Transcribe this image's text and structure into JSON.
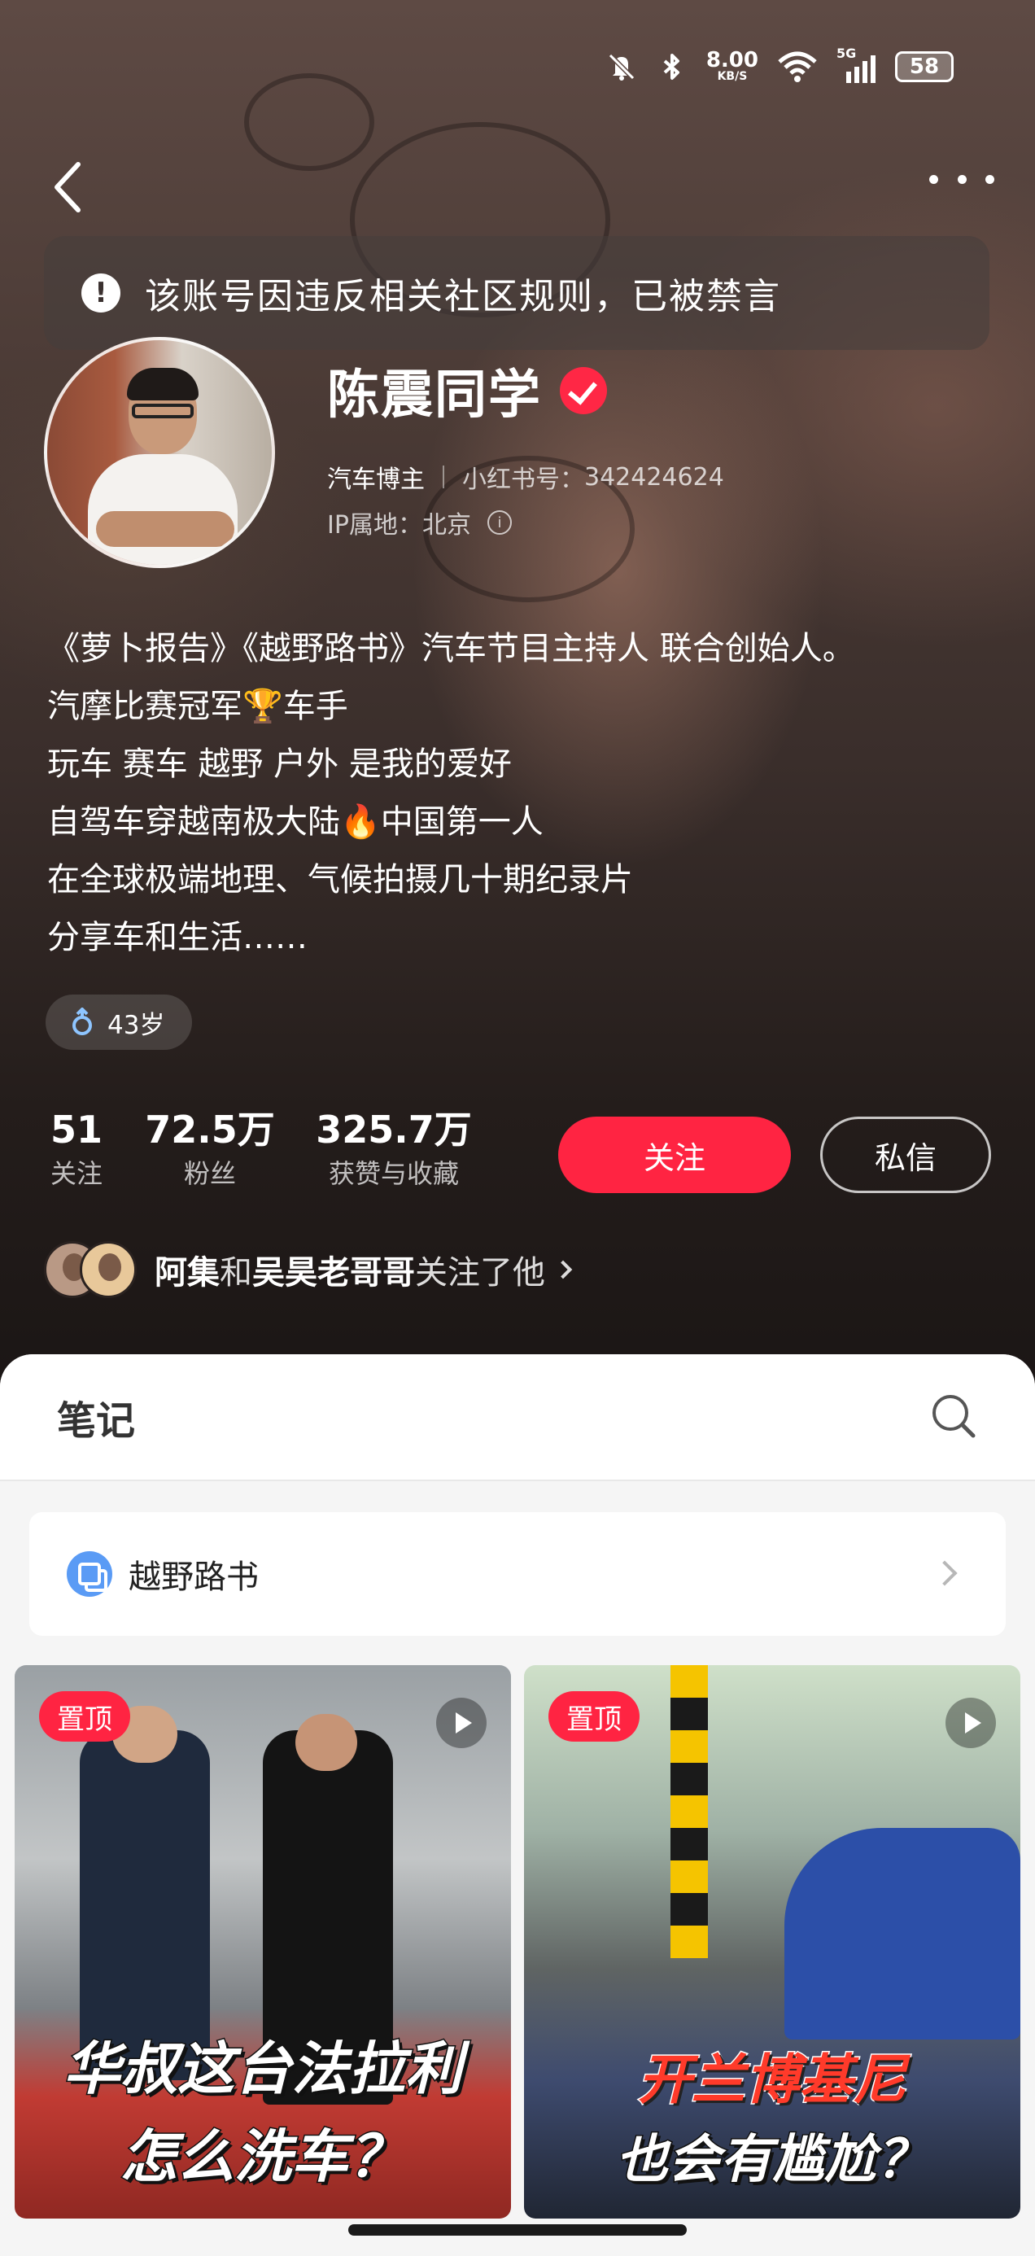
{
  "status_bar": {
    "speed": "8.00",
    "speed_unit": "KB/S",
    "network": "5G",
    "battery": "58",
    "icons": [
      "mute-icon",
      "bluetooth-icon",
      "wifi-icon",
      "signal-icon",
      "battery-icon"
    ]
  },
  "notice": "该账号因违反相关社区规则，已被禁言",
  "profile": {
    "name": "陈震同学",
    "category": "汽车博主",
    "id_label": "小红书号：",
    "id_value": "342424624",
    "ip_label": "IP属地：",
    "ip_value": "北京",
    "bio": [
      "《萝卜报告》《越野路书》汽车节目主持人 联合创始人。",
      "汽摩比赛冠军🏆车手",
      "玩车 赛车 越野 户外 是我的爱好",
      "自驾车穿越南极大陆🔥中国第一人",
      "在全球极端地理、气候拍摄几十期纪录片",
      "分享车和生活……"
    ],
    "age_tag": "43岁",
    "stats": [
      {
        "value": "51",
        "label": "关注"
      },
      {
        "value": "72.5万",
        "label": "粉丝"
      },
      {
        "value": "325.7万",
        "label": "获赞与收藏"
      }
    ],
    "follow_label": "关注",
    "dm_label": "私信",
    "mutual": {
      "name1": "阿集",
      "joiner": "和",
      "name2": "吴昊老哥哥",
      "suffix": " 关注了他"
    }
  },
  "notes_tab": {
    "title": "笔记",
    "collection": "越野路书",
    "cards": [
      {
        "badge": "置顶",
        "caption_line1": "华叔这台法拉利",
        "caption_line2": "怎么洗车？"
      },
      {
        "badge": "置顶",
        "caption_line1": "开兰博基尼",
        "caption_line2": "也会有尴尬？"
      }
    ]
  },
  "colors": {
    "accent": "#ff2442",
    "verified": "#ff2745",
    "collection_icon": "#5a9bf5"
  }
}
